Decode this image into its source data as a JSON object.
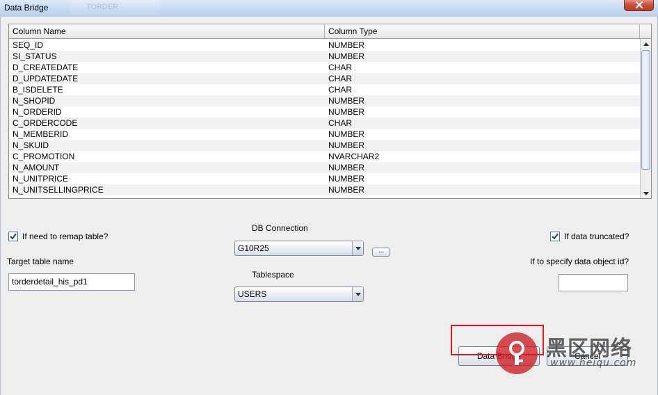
{
  "window": {
    "title": "Data Bridge",
    "background_title": "TORDER"
  },
  "table": {
    "headers": [
      "Column Name",
      "Column Type"
    ],
    "rows": [
      [
        "SEQ_ID",
        "NUMBER"
      ],
      [
        "SI_STATUS",
        "NUMBER"
      ],
      [
        "D_CREATEDATE",
        "CHAR"
      ],
      [
        "D_UPDATEDATE",
        "CHAR"
      ],
      [
        "B_ISDELETE",
        "CHAR"
      ],
      [
        "N_SHOPID",
        "NUMBER"
      ],
      [
        "N_ORDERID",
        "NUMBER"
      ],
      [
        "C_ORDERCODE",
        "CHAR"
      ],
      [
        "N_MEMBERID",
        "NUMBER"
      ],
      [
        "N_SKUID",
        "NUMBER"
      ],
      [
        "C_PROMOTION",
        "NVARCHAR2"
      ],
      [
        "N_AMOUNT",
        "NUMBER"
      ],
      [
        "N_UNITPRICE",
        "NUMBER"
      ],
      [
        "N_UNITSELLINGPRICE",
        "NUMBER"
      ]
    ]
  },
  "form": {
    "remap_label": "If need to remap table?",
    "remap_checked": true,
    "target_table_label": "Target table name",
    "target_table_value": "torderdetail_his_pd1",
    "db_connection_label": "DB Connection",
    "db_connection_value": "G10R25",
    "browse_button_label": "...",
    "tablespace_label": "Tablespace",
    "tablespace_value": "USERS",
    "truncated_label": "If data truncated?",
    "truncated_checked": true,
    "object_id_label": "If to specify data object id?",
    "object_id_value": ""
  },
  "buttons": {
    "data_bridge": "Data Bridge",
    "cancel": "Cancel"
  },
  "watermark": {
    "title": "黑区网络",
    "url": "www.heiqu.com"
  },
  "colors": {
    "highlight": "#e4161c",
    "watermark_red": "#cd1e23"
  }
}
